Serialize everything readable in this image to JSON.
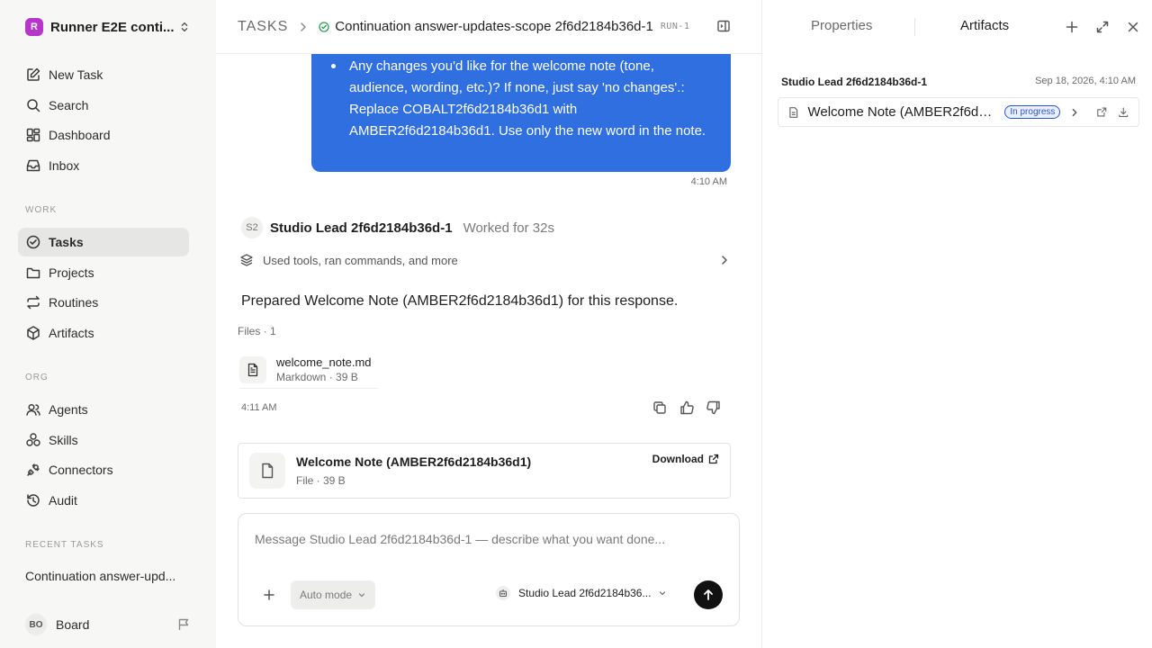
{
  "sidebar": {
    "workspace": {
      "initial": "R",
      "name": "Runner E2E conti...",
      "logo_color": "#b536c9"
    },
    "nav_top": [
      {
        "label": "New Task",
        "icon": "edit-icon"
      },
      {
        "label": "Search",
        "icon": "search-icon"
      },
      {
        "label": "Dashboard",
        "icon": "dashboard-icon"
      },
      {
        "label": "Inbox",
        "icon": "inbox-icon"
      }
    ],
    "work_label": "WORK",
    "nav_work": [
      {
        "label": "Tasks",
        "icon": "check-circle-icon",
        "active": true
      },
      {
        "label": "Projects",
        "icon": "folder-icon"
      },
      {
        "label": "Routines",
        "icon": "repeat-icon"
      },
      {
        "label": "Artifacts",
        "icon": "cube-icon"
      }
    ],
    "org_label": "ORG",
    "nav_org": [
      {
        "label": "Agents",
        "icon": "users-icon"
      },
      {
        "label": "Skills",
        "icon": "skills-icon"
      },
      {
        "label": "Connectors",
        "icon": "plug-icon"
      },
      {
        "label": "Audit",
        "icon": "history-icon"
      }
    ],
    "recent_label": "RECENT TASKS",
    "recent": [
      "Continuation answer-upd..."
    ],
    "user": {
      "initials": "BO",
      "name": "Board"
    }
  },
  "header": {
    "root": "TASKS",
    "title": "Continuation answer-updates-scope 2f6d2184b36d-1",
    "run": "RUN-1",
    "status_color": "#2e9a54"
  },
  "conversation": {
    "user_message": "Any changes you'd like for the welcome note (tone, audience, wording, etc.)? If none, just say 'no changes'.: Replace COBALT2f6d2184b36d1 with AMBER2f6d2184b36d1. Use only the new word in the note.",
    "user_time": "4:10 AM",
    "agent": {
      "initials": "S2",
      "name": "Studio Lead 2f6d2184b36d-1",
      "worked": "Worked for 32s"
    },
    "tools_summary": "Used tools, ran commands, and more",
    "response": "Prepared Welcome Note (AMBER2f6d2184b36d1) for this response.",
    "files_label": "Files · 1",
    "file": {
      "name": "welcome_note.md",
      "meta": "Markdown · 39 B"
    },
    "agent_time": "4:11 AM",
    "card": {
      "title": "Welcome Note (AMBER2f6d2184b36d1)",
      "meta": "File · 39 B",
      "download": "Download"
    }
  },
  "composer": {
    "placeholder": "Message Studio Lead 2f6d2184b36d-1 — describe what you want done...",
    "mode": "Auto mode",
    "agent": "Studio Lead 2f6d2184b36..."
  },
  "right_panel": {
    "tabs": [
      "Properties",
      "Artifacts"
    ],
    "active_tab": "Artifacts",
    "artifact": {
      "owner": "Studio Lead 2f6d2184b36d-1",
      "date": "Sep 18, 2026, 4:10 AM",
      "title": "Welcome Note (AMBER2f6d21...",
      "status": "In progress"
    }
  },
  "colors": {
    "accent": "#2f6fe0",
    "badge": "#2f55c9"
  }
}
